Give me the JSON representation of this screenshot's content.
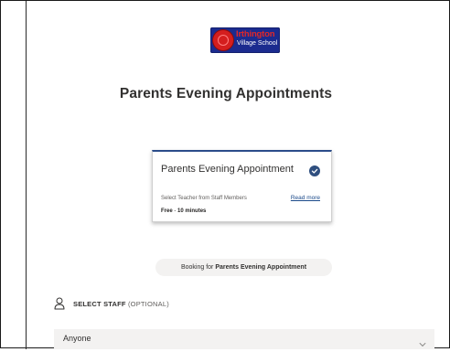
{
  "logo": {
    "line1": "Irthington",
    "line2": "Village School"
  },
  "page": {
    "title": "Parents Evening Appointments"
  },
  "service_card": {
    "title": "Parents Evening Appointment",
    "description": "Select Teacher from Staff Members",
    "read_more": "Read more",
    "price": "Free",
    "separator": " - ",
    "duration": "10 minutes",
    "selected": true,
    "check_icon": "checkmark-circle-icon"
  },
  "booking": {
    "prefix": "Booking for ",
    "service": "Parents Evening Appointment"
  },
  "staff": {
    "label": "SELECT STAFF",
    "optional": " (OPTIONAL)",
    "icon": "person-icon",
    "selected_value": "Anyone",
    "chevron_icon": "chevron-down-icon"
  },
  "colors": {
    "accent": "#2f4f7f",
    "link": "#1b4a8a",
    "logo_bg": "#1b2b8f",
    "logo_red": "#d41e1e",
    "surface": "#f3f2f1"
  }
}
